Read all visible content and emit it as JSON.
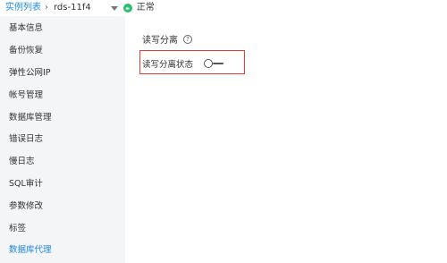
{
  "breadcrumb": {
    "parent_link": "实例列表",
    "separator": "›",
    "current": "rds-11f4",
    "status_text": "正常",
    "status_color": "#2dbd6e"
  },
  "sidebar": {
    "items": [
      {
        "label": "基本信息",
        "active": false
      },
      {
        "label": "备份恢复",
        "active": false
      },
      {
        "label": "弹性公网IP",
        "active": false
      },
      {
        "label": "帐号管理",
        "active": false
      },
      {
        "label": "数据库管理",
        "active": false
      },
      {
        "label": "错误日志",
        "active": false
      },
      {
        "label": "慢日志",
        "active": false
      },
      {
        "label": "SQL审计",
        "active": false
      },
      {
        "label": "参数修改",
        "active": false
      },
      {
        "label": "标签",
        "active": false
      },
      {
        "label": "数据库代理",
        "active": true
      }
    ],
    "active_color": "#1e88e5"
  },
  "main": {
    "section_title": "读写分离",
    "help_icon": "question-circle-icon",
    "help_glyph": "?",
    "setting": {
      "label": "读写分离状态",
      "toggle_state": "off"
    },
    "highlight_color": "#e53935"
  }
}
